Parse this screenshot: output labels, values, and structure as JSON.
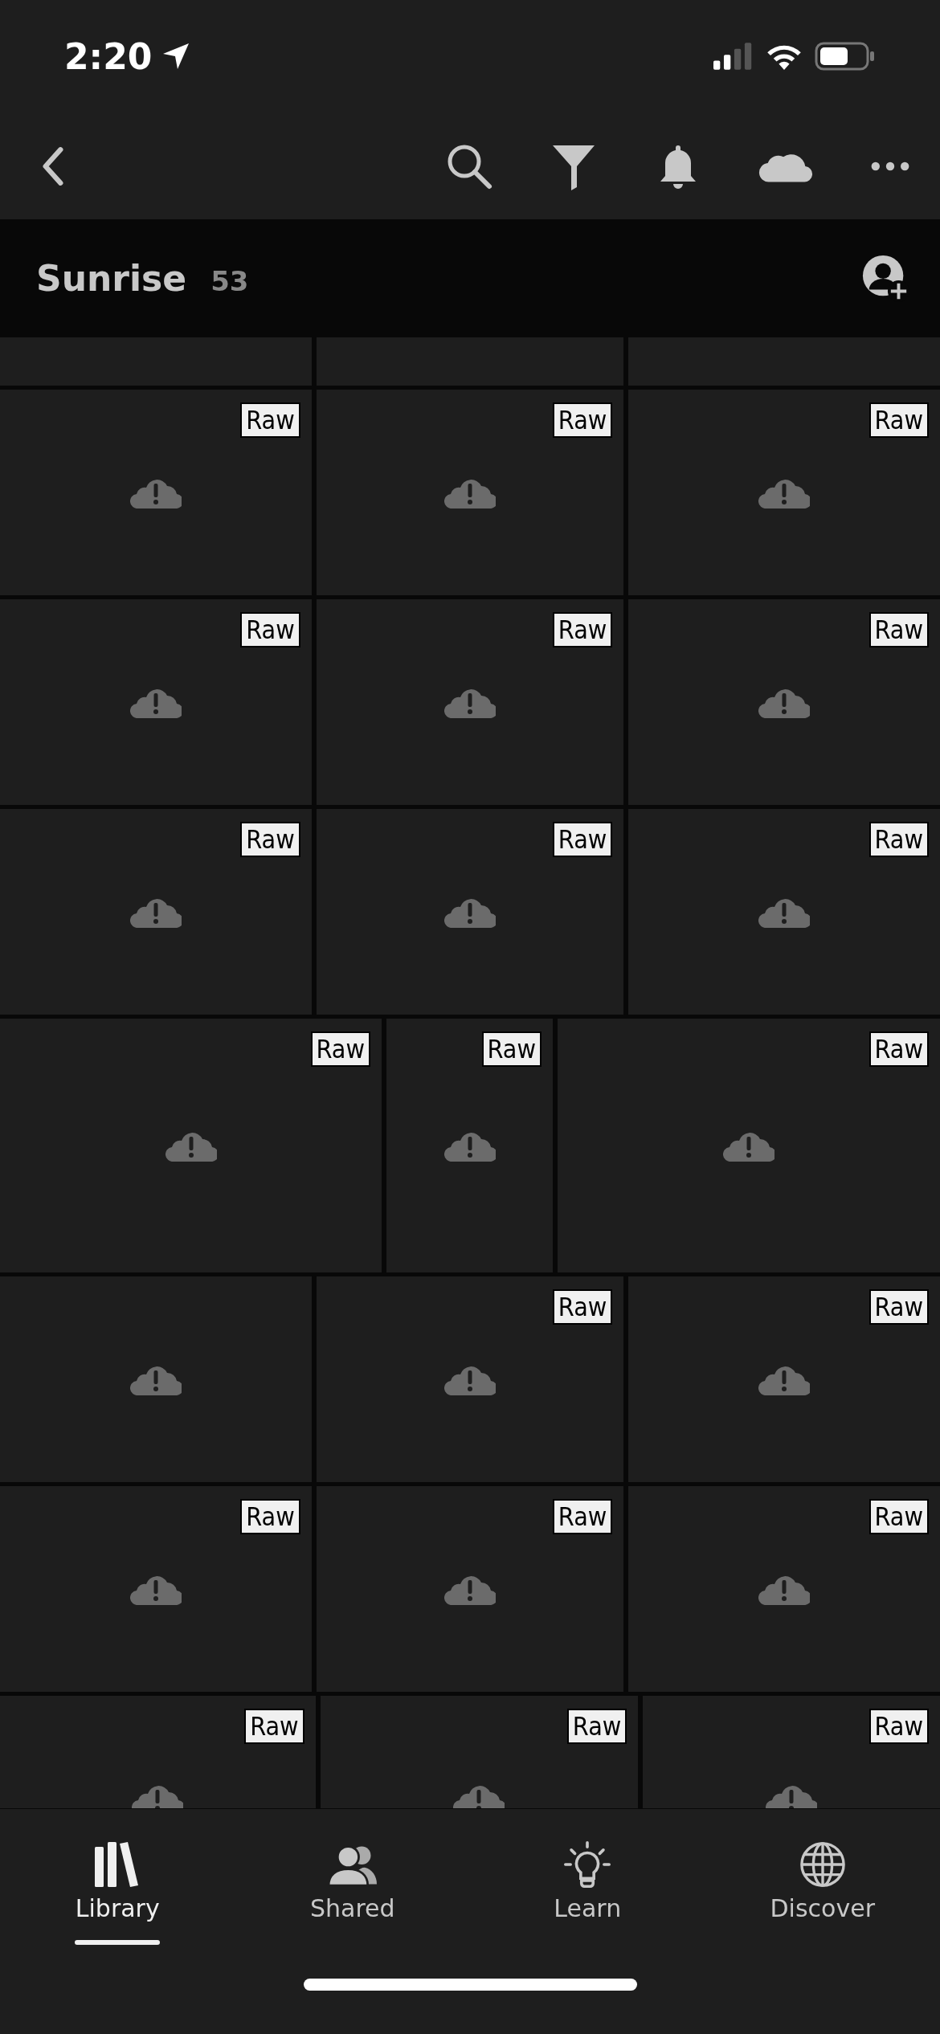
{
  "status_bar": {
    "time": "2:20"
  },
  "album": {
    "title": "Sunrise",
    "count": "53"
  },
  "grid_rows": [
    {
      "kind": "partial-top",
      "tiles": [
        {
          "kind": "placeholder"
        },
        {
          "kind": "placeholder"
        },
        {
          "kind": "placeholder"
        }
      ]
    },
    {
      "kind": "regular",
      "tiles": [
        {
          "kind": "placeholder",
          "badge": "Raw"
        },
        {
          "kind": "placeholder",
          "badge": "Raw"
        },
        {
          "kind": "placeholder",
          "badge": "Raw"
        }
      ]
    },
    {
      "kind": "regular",
      "tiles": [
        {
          "kind": "placeholder",
          "badge": "Raw"
        },
        {
          "kind": "placeholder",
          "badge": "Raw"
        },
        {
          "kind": "placeholder",
          "badge": "Raw"
        }
      ]
    },
    {
      "kind": "regular",
      "tiles": [
        {
          "kind": "placeholder",
          "badge": "Raw"
        },
        {
          "kind": "placeholder",
          "badge": "Raw"
        },
        {
          "kind": "placeholder",
          "badge": "Raw"
        }
      ]
    },
    {
      "kind": "tall",
      "tiles": [
        {
          "kind": "placeholder",
          "badge": "Raw"
        },
        {
          "kind": "placeholder",
          "badge": "Raw"
        },
        {
          "kind": "placeholder",
          "badge": "Raw"
        }
      ]
    },
    {
      "kind": "regular",
      "tiles": [
        {
          "kind": "placeholder"
        },
        {
          "kind": "placeholder",
          "badge": "Raw"
        },
        {
          "kind": "placeholder",
          "badge": "Raw"
        }
      ]
    },
    {
      "kind": "regular",
      "tiles": [
        {
          "kind": "placeholder",
          "badge": "Raw"
        },
        {
          "kind": "placeholder",
          "badge": "Raw"
        },
        {
          "kind": "placeholder",
          "badge": "Raw"
        }
      ]
    },
    {
      "kind": "partial-bottom",
      "tiles": [
        {
          "kind": "placeholder",
          "badge": "Raw"
        },
        {
          "kind": "placeholder",
          "badge": "Raw"
        },
        {
          "kind": "placeholder",
          "badge": "Raw"
        }
      ]
    }
  ],
  "tabs": [
    {
      "label": "Library",
      "kind": "library",
      "selected": true
    },
    {
      "label": "Shared",
      "kind": "shared",
      "selected": false
    },
    {
      "label": "Learn",
      "kind": "learn",
      "selected": false
    },
    {
      "label": "Discover",
      "kind": "discover",
      "selected": false
    }
  ]
}
